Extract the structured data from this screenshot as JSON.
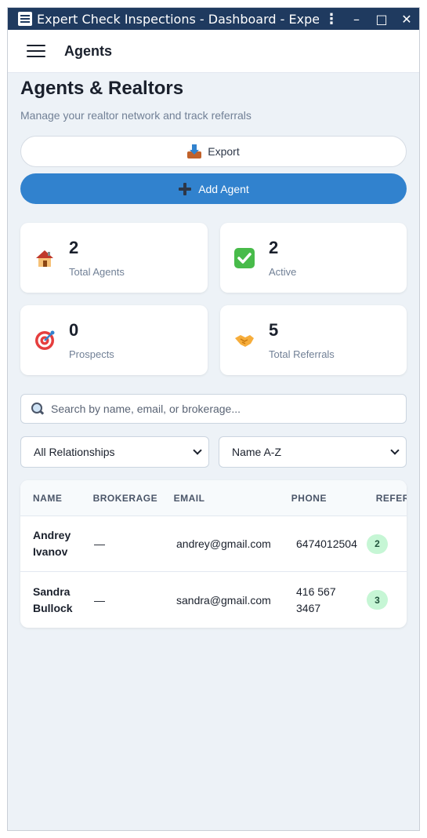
{
  "window": {
    "title": "Expert Check Inspections - Dashboard - Expert...",
    "controls": {
      "menu": "⋮",
      "minimize": "–",
      "maximize": "□",
      "close": "✕"
    }
  },
  "appbar": {
    "title": "Agents"
  },
  "page": {
    "title": "Agents & Realtors",
    "subtitle": "Manage your realtor network and track referrals"
  },
  "actions": {
    "export_label": "Export",
    "add_label": "Add Agent"
  },
  "stats": [
    {
      "icon": "house-icon",
      "value": "2",
      "label": "Total Agents"
    },
    {
      "icon": "check-mark-icon",
      "value": "2",
      "label": "Active"
    },
    {
      "icon": "target-icon",
      "value": "0",
      "label": "Prospects"
    },
    {
      "icon": "handshake-icon",
      "value": "5",
      "label": "Total Referrals"
    }
  ],
  "search": {
    "placeholder": "Search by name, email, or brokerage..."
  },
  "filters": {
    "relationship": "All Relationships",
    "sort": "Name A-Z"
  },
  "table": {
    "headers": [
      "NAME",
      "BROKERAGE",
      "EMAIL",
      "PHONE",
      "REFERRALS"
    ],
    "rows": [
      {
        "name_first": "Andrey",
        "name_last": "Ivanov",
        "brokerage": "—",
        "email": "andrey@gmail.com",
        "phone_1": "6474012504",
        "phone_2": "",
        "referrals": "2"
      },
      {
        "name_first": "Sandra",
        "name_last": "Bullock",
        "brokerage": "—",
        "email": "sandra@gmail.com",
        "phone_1": "416 567",
        "phone_2": "3467",
        "referrals": "3"
      }
    ]
  },
  "colors": {
    "titlebar": "#1f3a5f",
    "primary": "#3182ce",
    "background": "#edf2f7",
    "badge_bg": "#c6f6d5"
  }
}
